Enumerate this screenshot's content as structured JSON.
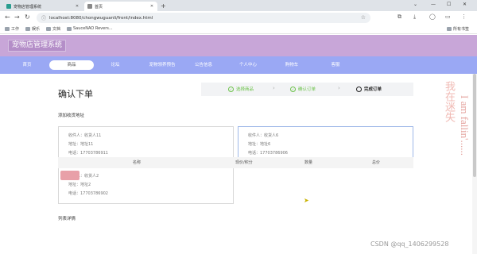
{
  "browser": {
    "tabs": [
      {
        "title": "宠物店管理系统",
        "favicon_color": "#2a9d8f"
      },
      {
        "title": "首页",
        "favicon_color": "#888888"
      }
    ],
    "new_tab": "+",
    "window_controls": [
      "⌄",
      "—",
      "☐",
      "✕"
    ],
    "url": "localhost:8080/chongwuguanli/front/index.html",
    "bookmarks": [
      "工作",
      "娱乐",
      "文档",
      "SauceNAO Revers..."
    ],
    "other_bookmarks": "所有书签"
  },
  "site": {
    "title": "宠物店管理系统",
    "colors": {
      "header": "#c8a6d8",
      "nav": "#9aa8f4",
      "accent_green": "#6cc24a"
    }
  },
  "nav": {
    "items": [
      "首页",
      "商品",
      "论坛",
      "宠物领养预告",
      "公告信息",
      "个人中心",
      "购物车",
      "客服"
    ],
    "active_index": 1
  },
  "order": {
    "title": "确认下单",
    "steps": [
      {
        "label": "选择商品",
        "state": "done"
      },
      {
        "label": "确认订单",
        "state": "done"
      },
      {
        "label": "完成订单",
        "state": "current"
      }
    ],
    "add_address_label": "添加收货地址",
    "addresses": [
      {
        "recipient": "收件人：收货人11",
        "address": "地址：地址11",
        "phone": "电话：17703786911",
        "selected": false
      },
      {
        "recipient": "收件人：收货人6",
        "address": "地址：地址6",
        "phone": "电话：17703786906",
        "selected": true
      },
      {
        "recipient": "收件人：收货人2",
        "address": "地址：地址2",
        "phone": "电话：17703786902",
        "selected": false
      }
    ],
    "list_label": "列表详情",
    "table_headers": [
      "名称",
      "现价/积分",
      "数量",
      "总价"
    ]
  },
  "decor": {
    "side_text_1": "I am fallin'......",
    "side_text_2": "我在迷失"
  },
  "watermark": "CSDN @qq_1406299528"
}
